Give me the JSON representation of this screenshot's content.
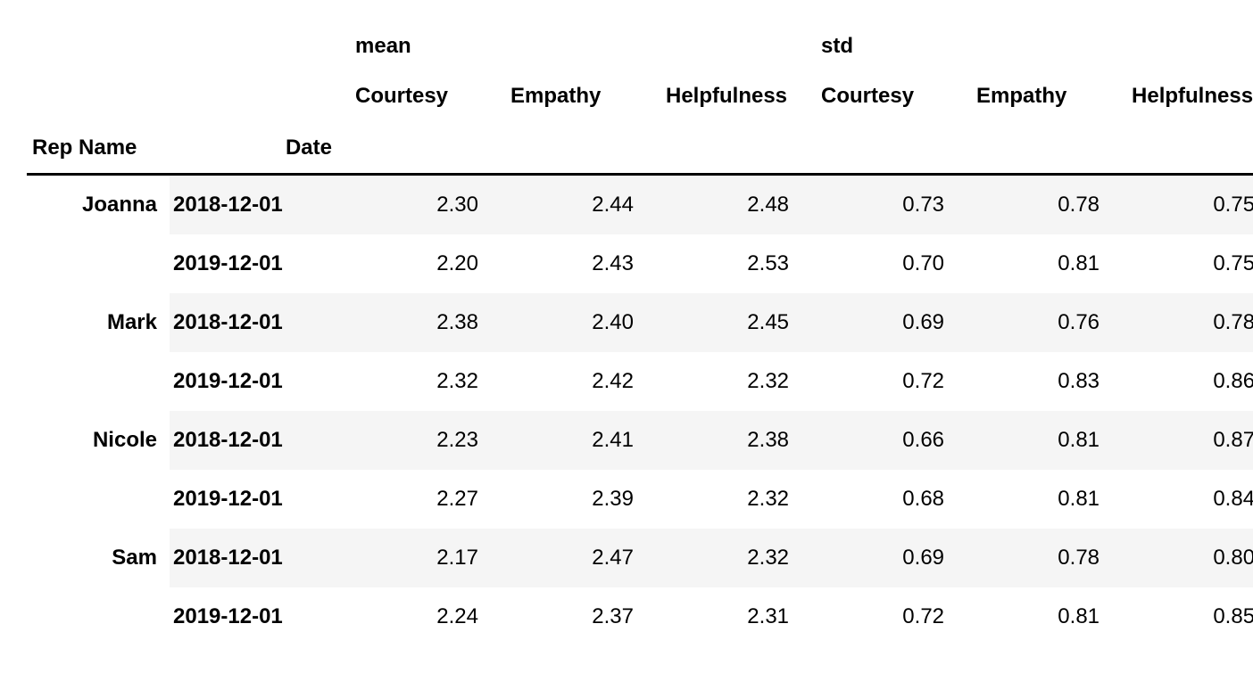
{
  "headers": {
    "groups": [
      "mean",
      "std"
    ],
    "metrics": [
      "Courtesy",
      "Empathy",
      "Helpfulness"
    ],
    "index": {
      "rep": "Rep Name",
      "date": "Date"
    }
  },
  "rows": [
    {
      "rep": "Joanna",
      "date": "2018-12-01",
      "mean": {
        "Courtesy": "2.30",
        "Empathy": "2.44",
        "Helpfulness": "2.48"
      },
      "std": {
        "Courtesy": "0.73",
        "Empathy": "0.78",
        "Helpfulness": "0.75"
      },
      "show_rep": true
    },
    {
      "rep": "Joanna",
      "date": "2019-12-01",
      "mean": {
        "Courtesy": "2.20",
        "Empathy": "2.43",
        "Helpfulness": "2.53"
      },
      "std": {
        "Courtesy": "0.70",
        "Empathy": "0.81",
        "Helpfulness": "0.75"
      },
      "show_rep": false
    },
    {
      "rep": "Mark",
      "date": "2018-12-01",
      "mean": {
        "Courtesy": "2.38",
        "Empathy": "2.40",
        "Helpfulness": "2.45"
      },
      "std": {
        "Courtesy": "0.69",
        "Empathy": "0.76",
        "Helpfulness": "0.78"
      },
      "show_rep": true
    },
    {
      "rep": "Mark",
      "date": "2019-12-01",
      "mean": {
        "Courtesy": "2.32",
        "Empathy": "2.42",
        "Helpfulness": "2.32"
      },
      "std": {
        "Courtesy": "0.72",
        "Empathy": "0.83",
        "Helpfulness": "0.86"
      },
      "show_rep": false
    },
    {
      "rep": "Nicole",
      "date": "2018-12-01",
      "mean": {
        "Courtesy": "2.23",
        "Empathy": "2.41",
        "Helpfulness": "2.38"
      },
      "std": {
        "Courtesy": "0.66",
        "Empathy": "0.81",
        "Helpfulness": "0.87"
      },
      "show_rep": true
    },
    {
      "rep": "Nicole",
      "date": "2019-12-01",
      "mean": {
        "Courtesy": "2.27",
        "Empathy": "2.39",
        "Helpfulness": "2.32"
      },
      "std": {
        "Courtesy": "0.68",
        "Empathy": "0.81",
        "Helpfulness": "0.84"
      },
      "show_rep": false
    },
    {
      "rep": "Sam",
      "date": "2018-12-01",
      "mean": {
        "Courtesy": "2.17",
        "Empathy": "2.47",
        "Helpfulness": "2.32"
      },
      "std": {
        "Courtesy": "0.69",
        "Empathy": "0.78",
        "Helpfulness": "0.80"
      },
      "show_rep": true
    },
    {
      "rep": "Sam",
      "date": "2019-12-01",
      "mean": {
        "Courtesy": "2.24",
        "Empathy": "2.37",
        "Helpfulness": "2.31"
      },
      "std": {
        "Courtesy": "0.72",
        "Empathy": "0.81",
        "Helpfulness": "0.85"
      },
      "show_rep": false
    }
  ],
  "chart_data": {
    "type": "table",
    "index_names": [
      "Rep Name",
      "Date"
    ],
    "column_groups": [
      "mean",
      "std"
    ],
    "column_metrics": [
      "Courtesy",
      "Empathy",
      "Helpfulness"
    ],
    "data": [
      {
        "Rep Name": "Joanna",
        "Date": "2018-12-01",
        "mean_Courtesy": 2.3,
        "mean_Empathy": 2.44,
        "mean_Helpfulness": 2.48,
        "std_Courtesy": 0.73,
        "std_Empathy": 0.78,
        "std_Helpfulness": 0.75
      },
      {
        "Rep Name": "Joanna",
        "Date": "2019-12-01",
        "mean_Courtesy": 2.2,
        "mean_Empathy": 2.43,
        "mean_Helpfulness": 2.53,
        "std_Courtesy": 0.7,
        "std_Empathy": 0.81,
        "std_Helpfulness": 0.75
      },
      {
        "Rep Name": "Mark",
        "Date": "2018-12-01",
        "mean_Courtesy": 2.38,
        "mean_Empathy": 2.4,
        "mean_Helpfulness": 2.45,
        "std_Courtesy": 0.69,
        "std_Empathy": 0.76,
        "std_Helpfulness": 0.78
      },
      {
        "Rep Name": "Mark",
        "Date": "2019-12-01",
        "mean_Courtesy": 2.32,
        "mean_Empathy": 2.42,
        "mean_Helpfulness": 2.32,
        "std_Courtesy": 0.72,
        "std_Empathy": 0.83,
        "std_Helpfulness": 0.86
      },
      {
        "Rep Name": "Nicole",
        "Date": "2018-12-01",
        "mean_Courtesy": 2.23,
        "mean_Empathy": 2.41,
        "mean_Helpfulness": 2.38,
        "std_Courtesy": 0.66,
        "std_Empathy": 0.81,
        "std_Helpfulness": 0.87
      },
      {
        "Rep Name": "Nicole",
        "Date": "2019-12-01",
        "mean_Courtesy": 2.27,
        "mean_Empathy": 2.39,
        "mean_Helpfulness": 2.32,
        "std_Courtesy": 0.68,
        "std_Empathy": 0.81,
        "std_Helpfulness": 0.84
      },
      {
        "Rep Name": "Sam",
        "Date": "2018-12-01",
        "mean_Courtesy": 2.17,
        "mean_Empathy": 2.47,
        "mean_Helpfulness": 2.32,
        "std_Courtesy": 0.69,
        "std_Empathy": 0.78,
        "std_Helpfulness": 0.8
      },
      {
        "Rep Name": "Sam",
        "Date": "2019-12-01",
        "mean_Courtesy": 2.24,
        "mean_Empathy": 2.37,
        "mean_Helpfulness": 2.31,
        "std_Courtesy": 0.72,
        "std_Empathy": 0.81,
        "std_Helpfulness": 0.85
      }
    ]
  }
}
